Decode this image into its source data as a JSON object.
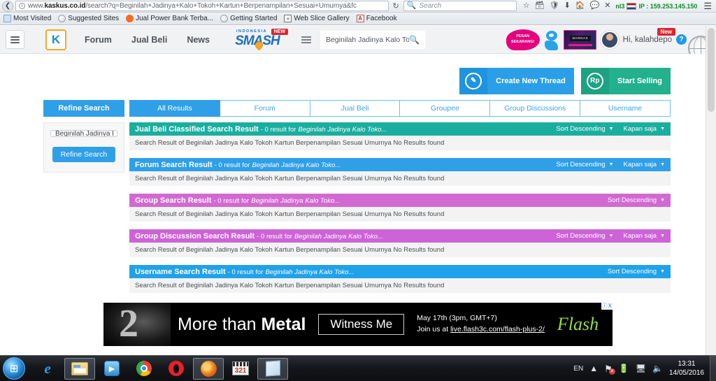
{
  "browser": {
    "url_prefix": "www.",
    "url_domain": "kaskus.co.id",
    "url_path": "/search?q=Beginilah+Jadinya+Kalo+Tokoh+Kartun+Berpenampilan+Sesuai+Umurnya&fc",
    "search_placeholder": "Search",
    "ip_country_code": "nl3",
    "ip_label": "IP : 159.253.145.150",
    "bookmarks": [
      {
        "label": "Most Visited",
        "icon": "bookmark-icon"
      },
      {
        "label": "Suggested Sites",
        "icon": "globe-icon"
      },
      {
        "label": "Jual Power Bank Terba...",
        "icon": "site-icon"
      },
      {
        "label": "Getting Started",
        "icon": "globe-icon"
      },
      {
        "label": "Web Slice Gallery",
        "icon": "webslice-icon"
      },
      {
        "label": "Facebook",
        "icon": "facebook-icon"
      }
    ]
  },
  "site_header": {
    "logo_letter": "K",
    "nav": [
      "Forum",
      "Jual Beli",
      "News"
    ],
    "smash_logo": {
      "top_text": "INDONESIA",
      "main_text": "SMASH",
      "badge": "NEW"
    },
    "search_value": "Beginilah Jadinya Kalo Tok",
    "promo_bubble": "PESAN SEKARANG!",
    "banner_text": "WARNAS",
    "greeting": "Hi, kalahdepo",
    "new_badge": "New",
    "help_label": "?"
  },
  "actions": {
    "create_thread": "Create New Thread",
    "create_thread_icon": "pencil-icon",
    "start_selling": "Start Selling",
    "start_selling_icon": "Rp"
  },
  "tabs": {
    "refine_label": "Refine Search",
    "items": [
      {
        "label": "All Results",
        "active": true
      },
      {
        "label": "Forum",
        "active": false
      },
      {
        "label": "Jual Beli",
        "active": false
      },
      {
        "label": "Groupee",
        "active": false
      },
      {
        "label": "Group Discussions",
        "active": false
      },
      {
        "label": "Username",
        "active": false
      }
    ]
  },
  "sidebar": {
    "input_value": "Beginilah Jadinya I",
    "button_label": "Refine Search"
  },
  "results": [
    {
      "title": "Jual Beli Classified Search Result",
      "count_text": "- 0 result for",
      "query": "Beginilah Jadinya Kalo Toko...",
      "body": "Search Result of Beginilah Jadinya Kalo Tokoh Kartun Berpenampilan Sesuai Umurnya No Results found",
      "sort_label": "Sort Descending",
      "time_label": "Kapan saja",
      "has_time": true,
      "color": "#1aae9f"
    },
    {
      "title": "Forum Search Result",
      "count_text": "- 0 result for",
      "query": "Beginilah Jadinya Kalo Toko...",
      "body": "Search Result of Beginilah Jadinya Kalo Tokoh Kartun Berpenampilan Sesuai Umurnya No Results found",
      "sort_label": "Sort Descending",
      "time_label": "Kapan saja",
      "has_time": true,
      "color": "#2f9fe8"
    },
    {
      "title": "Group Search Result",
      "count_text": "- 0 result for",
      "query": "Beginilah Jadinya Kalo Toko...",
      "body": "Search Result of Beginilah Jadinya Kalo Tokoh Kartun Berpenampilan Sesuai Umurnya No Results found",
      "sort_label": "Sort Descending",
      "time_label": "",
      "has_time": false,
      "color": "#d269d2"
    },
    {
      "title": "Group Discussion Search Result",
      "count_text": "- 0 result for",
      "query": "Beginilah Jadinya Kalo Toko...",
      "body": "Search Result of Beginilah Jadinya Kalo Tokoh Kartun Berpenampilan Sesuai Umurnya No Results found",
      "sort_label": "Sort Descending",
      "time_label": "Kapan saja",
      "has_time": true,
      "color": "#cd63d6"
    },
    {
      "title": "Username Search Result",
      "count_text": "- 0 result for",
      "query": "Beginilah Jadinya Kalo Toko...",
      "body": "Search Result of Beginilah Jadinya Kalo Tokoh Kartun Berpenampilan Sesuai Umurnya No Results found",
      "sort_label": "Sort Descending",
      "time_label": "",
      "has_time": false,
      "color": "#20a2ea"
    }
  ],
  "ad": {
    "numeral": "2",
    "headline_light": "More than ",
    "headline_bold": "Metal",
    "cta": "Witness Me",
    "line1": "May 17th (3pm, GMT+7)",
    "line2_prefix": "Join us at ",
    "line2_link": "live.flash3c.com/flash-plus-2/",
    "brand": "Flash",
    "badge_info": "ⓘ",
    "badge_close": "X"
  },
  "taskbar": {
    "items": [
      {
        "name": "internet-explorer",
        "open": false
      },
      {
        "name": "file-explorer",
        "open": true
      },
      {
        "name": "windows-media-player",
        "open": false
      },
      {
        "name": "google-chrome",
        "open": false
      },
      {
        "name": "opera",
        "open": false
      },
      {
        "name": "mozilla-firefox",
        "open": true
      },
      {
        "name": "media-player-classic",
        "open": false
      },
      {
        "name": "notepad",
        "open": true
      }
    ],
    "language": "EN",
    "time": "13:31",
    "date": "14/05/2016"
  }
}
